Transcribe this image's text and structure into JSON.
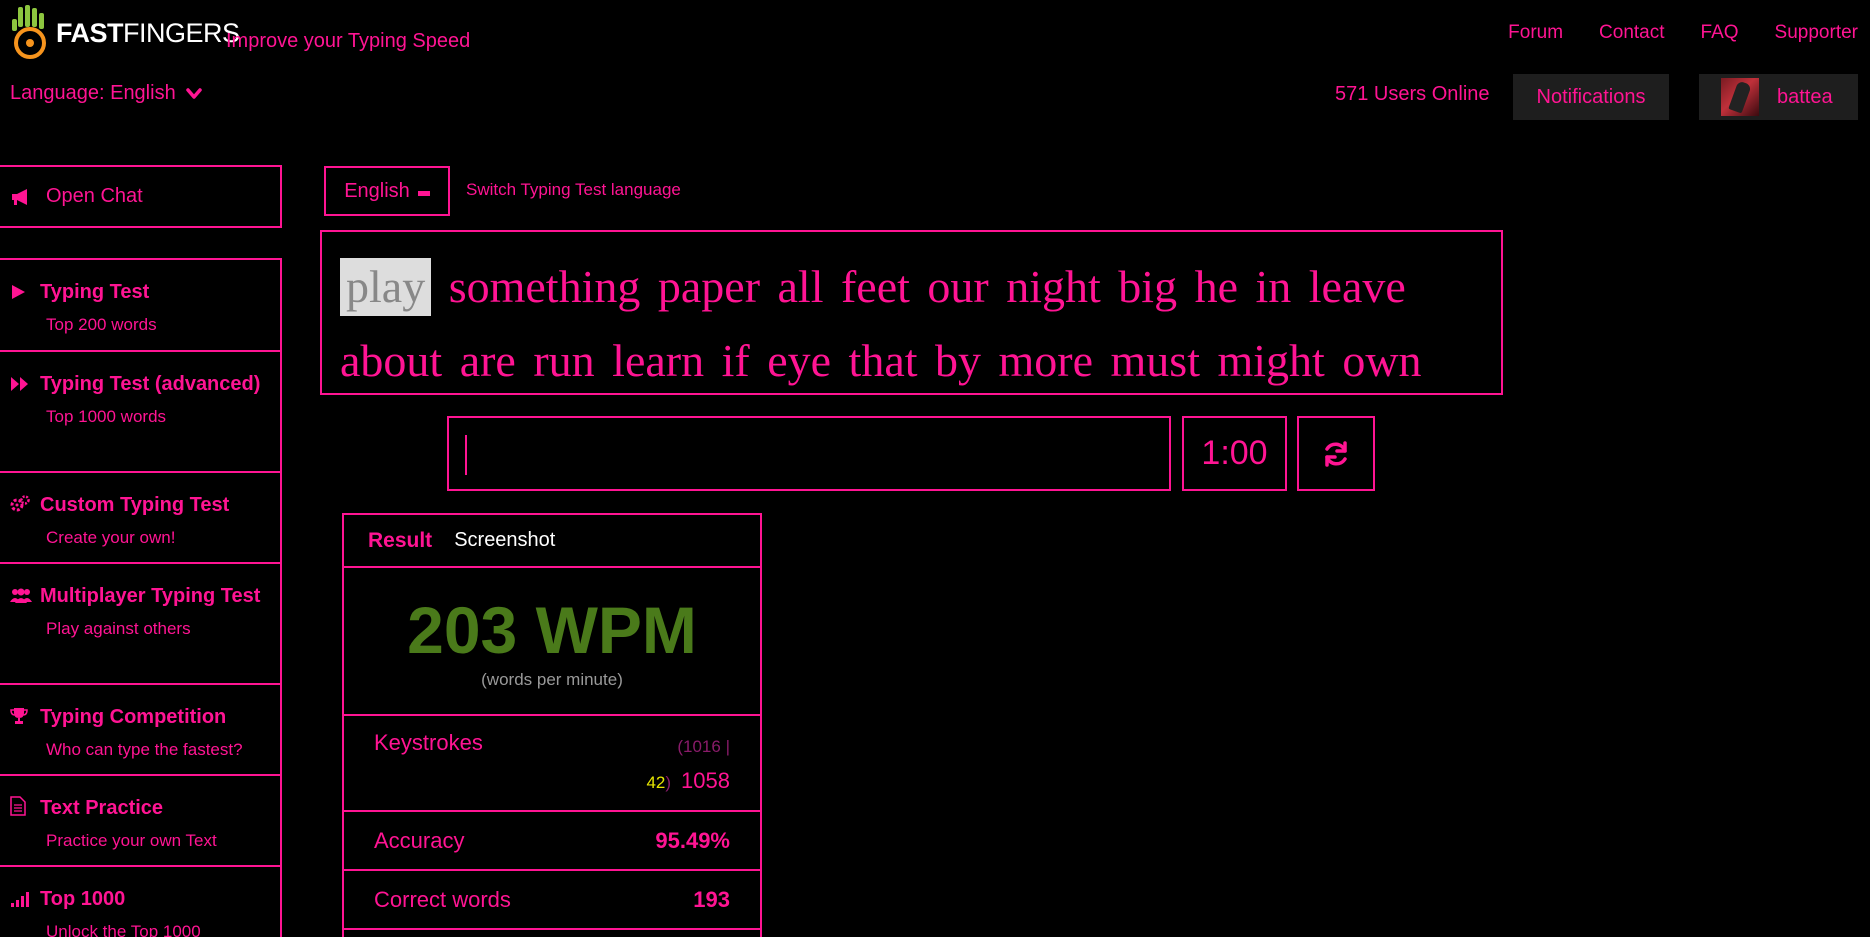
{
  "header": {
    "logo_bold": "FAST",
    "logo_light": "FINGERS",
    "tagline": "Improve your Typing Speed",
    "language_label": "Language: English",
    "nav": [
      "Forum",
      "Contact",
      "FAQ",
      "Supporter"
    ],
    "users_online": "571 Users Online",
    "notifications": "Notifications",
    "username": "battea"
  },
  "sidebar": {
    "open_chat": "Open Chat",
    "items": [
      {
        "title": "Typing Test",
        "sub": "Top 200 words",
        "icon": "play-icon"
      },
      {
        "title": "Typing Test (advanced)",
        "sub": "Top 1000 words",
        "icon": "fast-forward-icon"
      },
      {
        "title": "Custom Typing Test",
        "sub": "Create your own!",
        "icon": "gears-icon"
      },
      {
        "title": "Multiplayer Typing Test",
        "sub": "Play against others",
        "icon": "users-icon"
      },
      {
        "title": "Typing Competition",
        "sub": "Who can type the fastest?",
        "icon": "trophy-icon"
      },
      {
        "title": "Text Practice",
        "sub": "Practice your own Text",
        "icon": "document-icon"
      },
      {
        "title": "Top 1000",
        "sub": "Unlock the Top 1000",
        "icon": "signal-icon"
      }
    ]
  },
  "test": {
    "language_button": "English",
    "switch_language": "Switch Typing Test language",
    "current_word": "play",
    "line1": "something paper all feet our night big he in leave",
    "line2": "about are run learn if eye that by more must might own",
    "input_value": "",
    "timer": "1:00"
  },
  "result": {
    "tab_result": "Result",
    "tab_screenshot": "Screenshot",
    "wpm": "203 WPM",
    "wpm_sub": "(words per minute)",
    "keystrokes_label": "Keystrokes",
    "keystrokes_correct": "1016",
    "keystrokes_wrong": "42",
    "keystrokes_total": "1058",
    "accuracy_label": "Accuracy",
    "accuracy_value": "95.49%",
    "correct_words_label": "Correct words",
    "correct_words_value": "193"
  },
  "colors": {
    "accent": "#ff1493",
    "background": "#000000",
    "wpm_green": "#4a7a1a",
    "error_yellow": "#e6e600"
  }
}
